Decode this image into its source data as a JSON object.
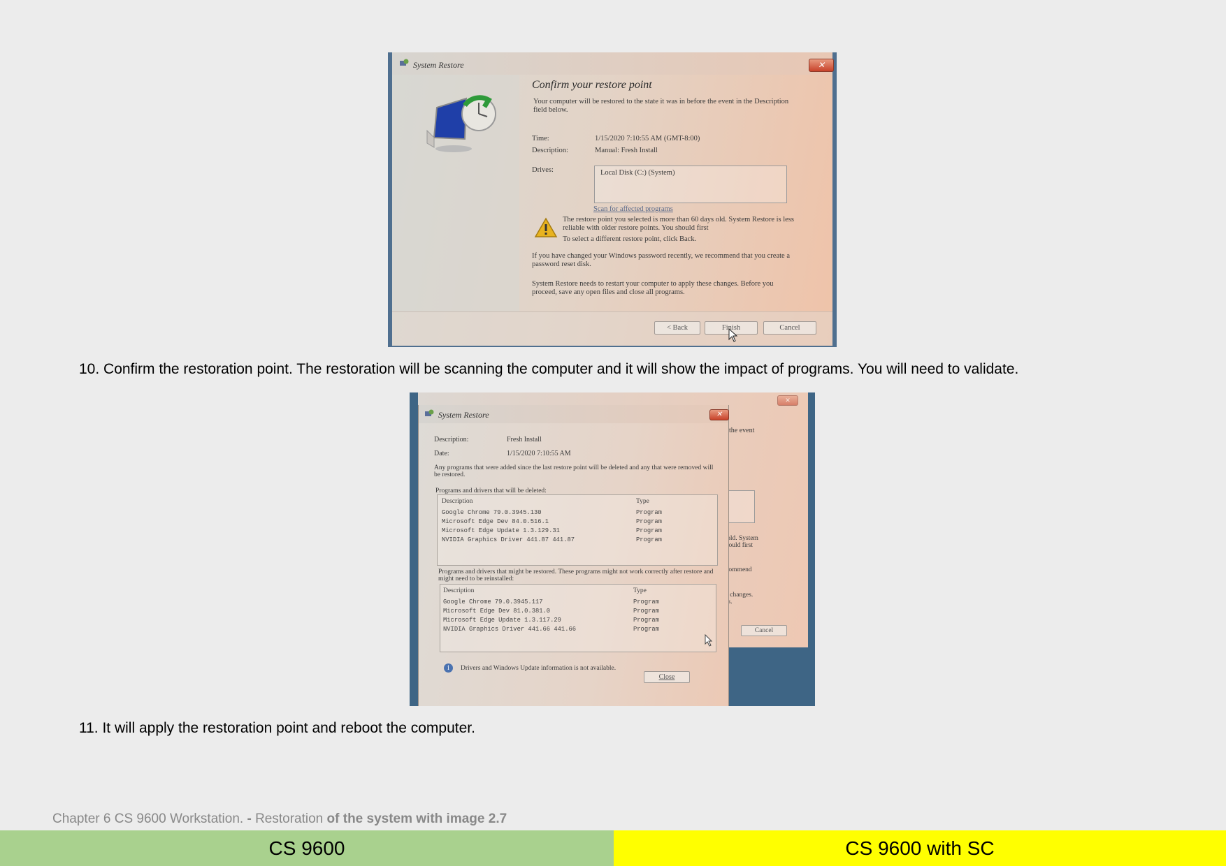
{
  "photo1": {
    "window_title": "System Restore",
    "close_label": "✕",
    "heading": "Confirm your restore point",
    "intro": "Your computer will be restored to the state it was in before the event in the Description field below.",
    "time_label": "Time:",
    "time_value": "1/15/2020 7:10:55 AM (GMT-8:00)",
    "description_label": "Description:",
    "description_value": "Manual: Fresh Install",
    "drives_label": "Drives:",
    "drives_value": "Local Disk (C:) (System)",
    "scan_link": "Scan for affected programs",
    "warning_text": "The restore point you selected is more than 60 days old. System Restore is less reliable with older restore points. You should first",
    "warning_text2": "To select a different restore point, click Back.",
    "password_note": "If you have changed your Windows password recently, we recommend that you create a password reset disk.",
    "restart_note": "System Restore needs to restart your computer to apply these changes. Before you proceed, save any open files and close all programs.",
    "back_button": "< Back",
    "finish_button": "Finish",
    "cancel_button": "Cancel"
  },
  "caption10": "10. Confirm the restoration point. The restoration will be scanning the computer and it will show the impact of programs. You will need to validate.",
  "photo2": {
    "window_title": "System Restore",
    "close_label": "✕",
    "description_label": "Description:",
    "description_value": "Fresh Install",
    "date_label": "Date:",
    "date_value": "1/15/2020 7:10:55 AM",
    "notice": "Any programs that were added since the last restore point will be deleted and any that were removed will be restored.",
    "deleted_heading": "Programs and drivers that will be deleted:",
    "col_description": "Description",
    "col_type": "Type",
    "deleted_rows": [
      {
        "name": "Google Chrome 79.0.3945.130",
        "type": "Program"
      },
      {
        "name": "Microsoft Edge Dev 84.0.516.1",
        "type": "Program"
      },
      {
        "name": "Microsoft Edge Update 1.3.129.31",
        "type": "Program"
      },
      {
        "name": "NVIDIA Graphics Driver 441.87 441.87",
        "type": "Program"
      }
    ],
    "restored_heading": "Programs and drivers that might be restored. These programs might not work correctly after restore and might need to be reinstalled:",
    "restored_rows": [
      {
        "name": "Google Chrome 79.0.3945.117",
        "type": "Program"
      },
      {
        "name": "Microsoft Edge Dev 81.0.381.0",
        "type": "Program"
      },
      {
        "name": "Microsoft Edge Update 1.3.117.29",
        "type": "Program"
      },
      {
        "name": "NVIDIA Graphics Driver 441.66 441.66",
        "type": "Program"
      }
    ],
    "info_text": "Drivers and Windows Update information is not available.",
    "close_button": "Close",
    "bg_fragments": {
      "event": "the event",
      "old": "s old. System",
      "first": "should first",
      "recommend": "ecommend",
      "changes": "se changes.",
      "ms": "ms.",
      "cancel": "Cancel"
    }
  },
  "caption11": "11. It will apply the restoration point and reboot the computer.",
  "footer": {
    "part1": "Chapter 6 CS 9600 Workstation. ",
    "part2": "- ",
    "part3": "Restoration ",
    "part4": "of the system with image 2.7"
  },
  "bands": {
    "left": "CS 9600",
    "right": "CS 9600 with SC",
    "left_color": "#a9d18e",
    "right_color": "#ffff00"
  }
}
